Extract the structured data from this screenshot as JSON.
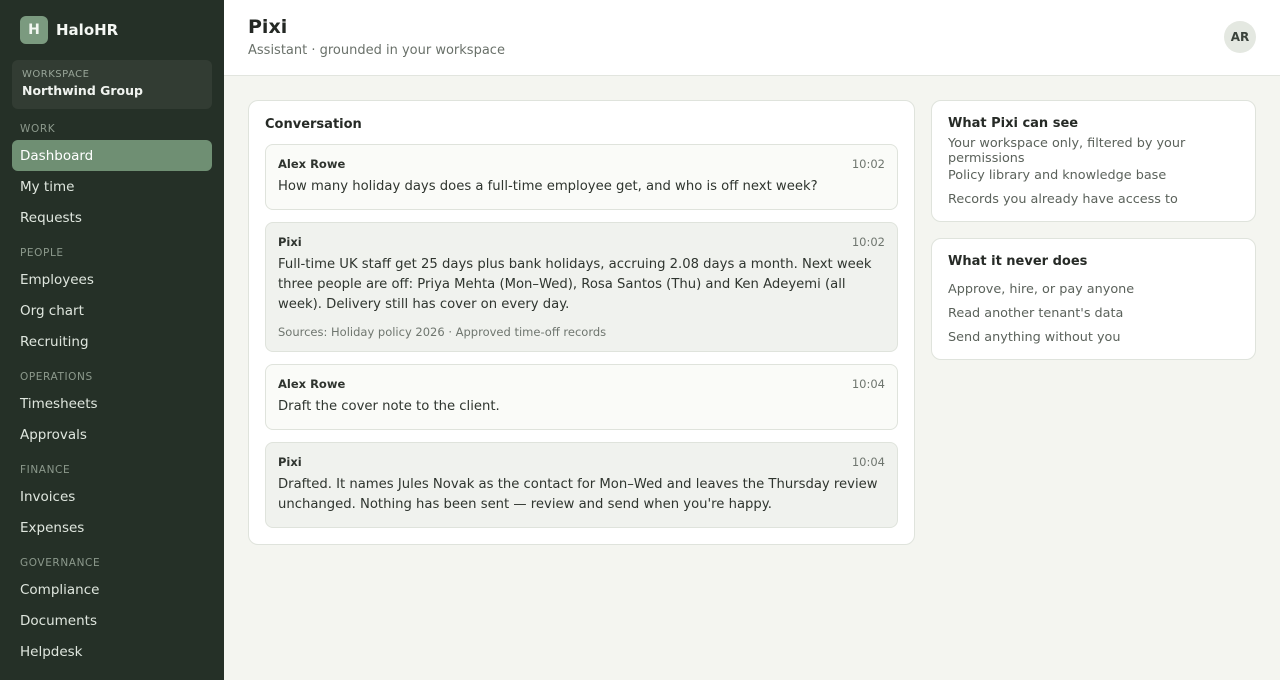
{
  "brand": {
    "logo_letter": "H",
    "name": "HaloHR"
  },
  "workspace": {
    "label": "Workspace",
    "name": "Northwind Group"
  },
  "nav": [
    {
      "title": "Work",
      "items": [
        "Dashboard",
        "My time",
        "Requests"
      ]
    },
    {
      "title": "People",
      "items": [
        "Employees",
        "Org chart",
        "Recruiting"
      ]
    },
    {
      "title": "Operations",
      "items": [
        "Timesheets",
        "Approvals"
      ]
    },
    {
      "title": "Finance",
      "items": [
        "Invoices",
        "Expenses"
      ]
    },
    {
      "title": "Governance",
      "items": [
        "Compliance",
        "Documents",
        "Helpdesk"
      ]
    }
  ],
  "active_nav": "Dashboard",
  "header": {
    "title": "Pixi",
    "subtitle": "Assistant · grounded in your workspace",
    "avatar_initials": "AR"
  },
  "conversation": {
    "title": "Conversation",
    "messages": [
      {
        "author": "Alex Rowe",
        "time": "10:02",
        "role": "user",
        "text": "How many holiday days does a full-time employee get, and who is off next week?"
      },
      {
        "author": "Pixi",
        "time": "10:02",
        "role": "assistant",
        "text": "Full-time UK staff get 25 days plus bank holidays, accruing 2.08 days a month. Next week three people are off: Priya Mehta (Mon–Wed), Rosa Santos (Thu) and Ken Adeyemi (all week). Delivery still has cover on every day.",
        "sources": "Sources: Holiday policy 2026 · Approved time-off records"
      },
      {
        "author": "Alex Rowe",
        "time": "10:04",
        "role": "user",
        "text": "Draft the cover note to the client."
      },
      {
        "author": "Pixi",
        "time": "10:04",
        "role": "assistant",
        "text": "Drafted. It names Jules Novak as the contact for Mon–Wed and leaves the Thursday review unchanged. Nothing has been sent — review and send when you're happy."
      }
    ]
  },
  "can_see": {
    "title": "What Pixi can see",
    "items": [
      "Your workspace only, filtered by your permissions",
      "Policy library and knowledge base",
      "Records you already have access to"
    ]
  },
  "never_does": {
    "title": "What it never does",
    "items": [
      "Approve, hire, or pay anyone",
      "Read another tenant's data",
      "Send anything without you"
    ]
  },
  "colors": {
    "sidebar_bg": "#253027",
    "active_nav_bg": "#6f8f73",
    "page_bg": "#f4f5f0"
  }
}
